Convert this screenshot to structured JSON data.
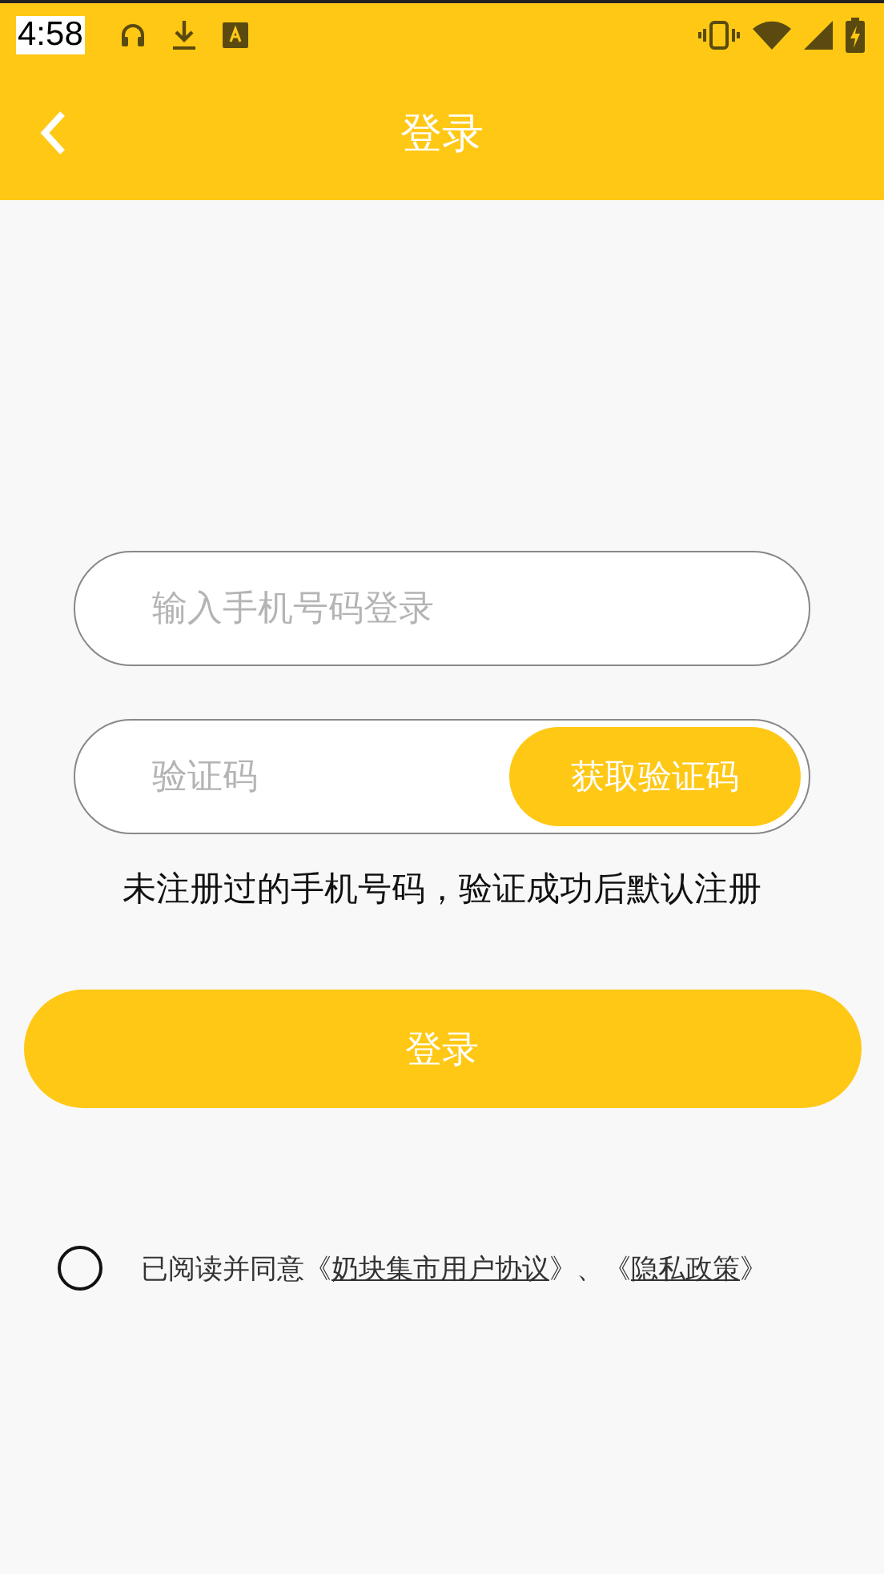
{
  "status_bar": {
    "time": "4:58"
  },
  "app_bar": {
    "title": "登录"
  },
  "phone_field": {
    "placeholder": "输入手机号码登录"
  },
  "code_field": {
    "placeholder": "验证码",
    "button": "获取验证码"
  },
  "hint": "未注册过的手机号码，验证成功后默认注册",
  "login_button": "登录",
  "agreement": {
    "checked": false,
    "parts": [
      {
        "kind": "text",
        "text": "已阅读并同意《"
      },
      {
        "kind": "link",
        "text": "奶块集市用户协议"
      },
      {
        "kind": "text",
        "text": "》、《"
      },
      {
        "kind": "link",
        "text": "隐私政策"
      },
      {
        "kind": "text",
        "text": "》"
      }
    ]
  }
}
